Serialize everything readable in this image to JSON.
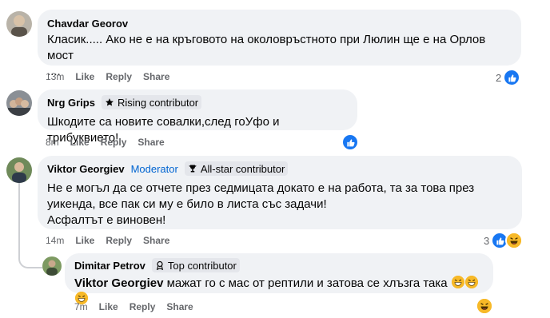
{
  "comments": [
    {
      "author": "Chavdar Georov",
      "text_line1": "Класик..... Ако не е на кръговото на околовръстното при Люлин ще е на Орлов мост",
      "text_line2": "....",
      "time": "13m",
      "like": "Like",
      "reply": "Reply",
      "share": "Share",
      "reaction_count": "2"
    },
    {
      "author": "Nrg Grips",
      "badge": "Rising contributor",
      "text": "Шкодите са новите совалки,след гоУфо и трибуквието!",
      "time": "8m",
      "like": "Like",
      "reply": "Reply",
      "share": "Share"
    },
    {
      "author": "Viktor Georgiev",
      "role": "Moderator",
      "badge": "All-star contributor",
      "text_line1": "Не е могъл да се отчете през седмицата докато е на работа, та за това през",
      "text_line2": "уикенда, все пак си му е било в листа със задачи!",
      "text_line3": "Асфалтът е виновен!",
      "time": "14m",
      "like": "Like",
      "reply": "Reply",
      "share": "Share",
      "reaction_count": "3"
    },
    {
      "author": "Dimitar Petrov",
      "badge": "Top contributor",
      "mention": "Viktor Georgiev",
      "text": " мажат го с мас от рептили и затова се хлъзга така",
      "time": "7m",
      "like": "Like",
      "reply": "Reply",
      "share": "Share"
    }
  ],
  "colors": {
    "bubble": "#f0f2f5",
    "like_blue": "#1877f2",
    "moderator_blue": "#0064d1",
    "meta_gray": "#65676b",
    "haha_yellow": "#f7b928"
  },
  "icons": [
    "like-icon",
    "haha-icon",
    "star-icon",
    "trophy-icon",
    "top-contributor-icon",
    "grinning-emoji-icon"
  ]
}
